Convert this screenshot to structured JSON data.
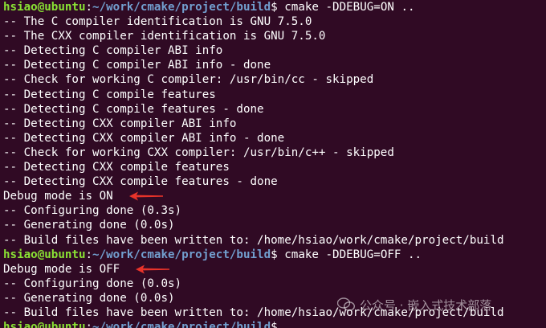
{
  "terminal": {
    "lines": [
      {
        "kind": "prompt",
        "user": "hsiao@ubuntu",
        "path": "~/work/cmake/project/build",
        "command": "cmake -DDEBUG=ON .."
      },
      {
        "kind": "out",
        "text": "-- The C compiler identification is GNU 7.5.0"
      },
      {
        "kind": "out",
        "text": "-- The CXX compiler identification is GNU 7.5.0"
      },
      {
        "kind": "out",
        "text": "-- Detecting C compiler ABI info"
      },
      {
        "kind": "out",
        "text": "-- Detecting C compiler ABI info - done"
      },
      {
        "kind": "out",
        "text": "-- Check for working C compiler: /usr/bin/cc - skipped"
      },
      {
        "kind": "out",
        "text": "-- Detecting C compile features"
      },
      {
        "kind": "out",
        "text": "-- Detecting C compile features - done"
      },
      {
        "kind": "out",
        "text": "-- Detecting CXX compiler ABI info"
      },
      {
        "kind": "out",
        "text": "-- Detecting CXX compiler ABI info - done"
      },
      {
        "kind": "out",
        "text": "-- Check for working CXX compiler: /usr/bin/c++ - skipped"
      },
      {
        "kind": "out",
        "text": "-- Detecting CXX compile features"
      },
      {
        "kind": "out",
        "text": "-- Detecting CXX compile features - done"
      },
      {
        "kind": "out",
        "text": "Debug mode is ON",
        "arrow": true
      },
      {
        "kind": "out",
        "text": "-- Configuring done (0.3s)"
      },
      {
        "kind": "out",
        "text": "-- Generating done (0.0s)"
      },
      {
        "kind": "out",
        "text": "-- Build files have been written to: /home/hsiao/work/cmake/project/build"
      },
      {
        "kind": "prompt",
        "user": "hsiao@ubuntu",
        "path": "~/work/cmake/project/build",
        "command": "cmake -DDEBUG=OFF .."
      },
      {
        "kind": "out",
        "text": "Debug mode is OFF",
        "arrow": true
      },
      {
        "kind": "out",
        "text": "-- Configuring done (0.0s)"
      },
      {
        "kind": "out",
        "text": "-- Generating done (0.0s)"
      },
      {
        "kind": "out",
        "text": "-- Build files have been written to: /home/hsiao/work/cmake/project/build"
      },
      {
        "kind": "prompt",
        "user": "hsiao@ubuntu",
        "path": "~/work/cmake/project/build",
        "command": ""
      }
    ],
    "colors": {
      "background": "#300a24",
      "user": "#8ae234",
      "path": "#729fcf",
      "text": "#ffffff",
      "arrow": "#e8332a"
    }
  },
  "watermark": {
    "text": "公众号 · 嵌入式技术部落",
    "icon": "wechat-logo-icon"
  }
}
